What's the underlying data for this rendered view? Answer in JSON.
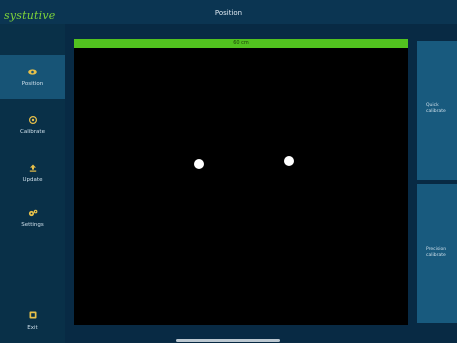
{
  "header": {
    "title": "Position"
  },
  "sidebar": {
    "logo": "systutive",
    "items": [
      {
        "label": "Position",
        "icon": "eye-icon"
      },
      {
        "label": "Calibrate",
        "icon": "target-icon"
      },
      {
        "label": "Update",
        "icon": "upload-icon"
      },
      {
        "label": "Settings",
        "icon": "gears-icon"
      }
    ],
    "exit_label": "Exit"
  },
  "main": {
    "status_label": "60 cm"
  },
  "right_panels": [
    {
      "line1": "Quick",
      "line2": "calibrate"
    },
    {
      "line1": "Precision",
      "line2": "calibrate"
    }
  ],
  "colors": {
    "background": "#082a44",
    "accent_green": "#52c21f",
    "active_nav": "#175476",
    "panel": "#185a7e"
  }
}
